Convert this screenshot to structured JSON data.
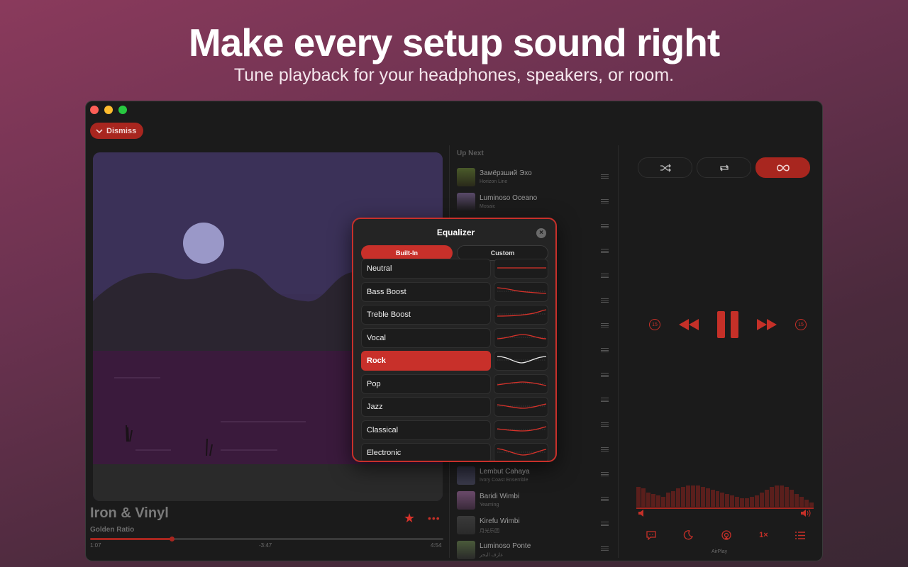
{
  "headline": "Make every setup sound right",
  "subline": "Tune playback for your headphones, speakers, or room.",
  "window": {
    "dismiss_label": "Dismiss",
    "now_playing": {
      "title": "Iron & Vinyl",
      "artist": "Golden Ratio",
      "elapsed": "1:07",
      "remaining": "-3:47",
      "duration": "4:54",
      "progress": 0.23
    },
    "up_next_label": "Up Next",
    "queue": [
      {
        "title": "Замёрзший Эхо",
        "artist": "Horizon Line"
      },
      {
        "title": "Luminoso Oceano",
        "artist": "Mosaic"
      },
      {
        "title": "Lembut Cahaya",
        "artist": "Ivory Coast Ensemble"
      },
      {
        "title": "Baridi Wimbi",
        "artist": "Yearning"
      },
      {
        "title": "Kirefu Wimbi",
        "artist": "月光乐团"
      },
      {
        "title": "Luminoso Ponte",
        "artist": "عازف البحر"
      }
    ],
    "airplay_label": "AirPlay",
    "speed_label": "1×",
    "skip_seconds": "15"
  },
  "equalizer": {
    "title": "Equalizer",
    "tabs": [
      "Built-In",
      "Custom"
    ],
    "active_tab": "Built-In",
    "presets": [
      "Neutral",
      "Bass Boost",
      "Treble Boost",
      "Vocal",
      "Rock",
      "Pop",
      "Jazz",
      "Classical",
      "Electronic"
    ],
    "selected_preset": "Rock"
  },
  "colors": {
    "accent": "#c8302a",
    "accent_dark": "#a8261f",
    "bg": "#1b1b1b"
  }
}
